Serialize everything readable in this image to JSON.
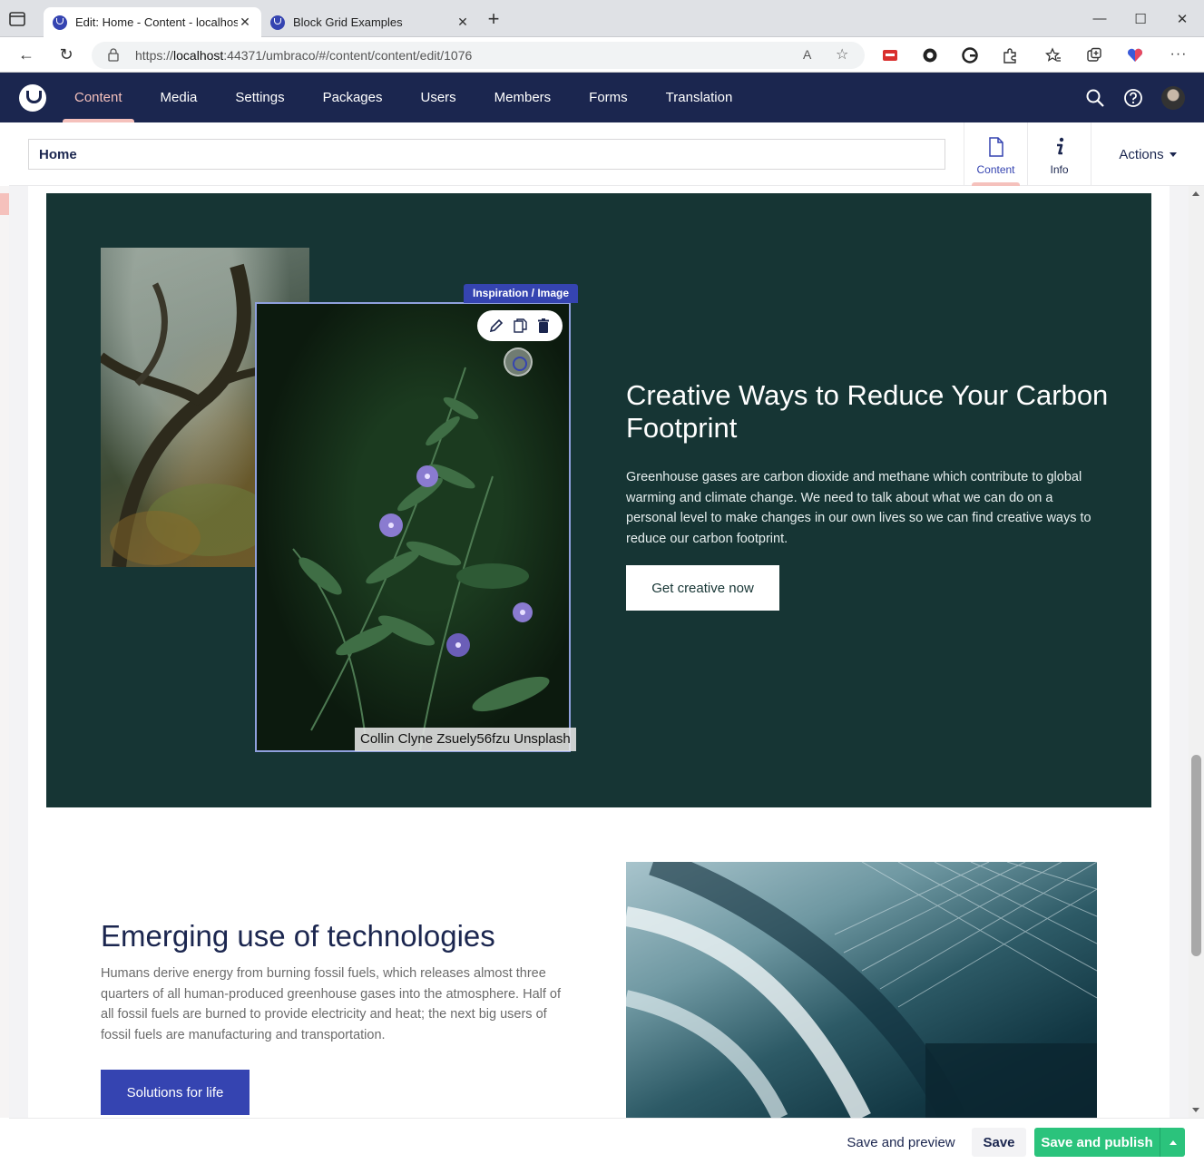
{
  "browser": {
    "tabs": [
      {
        "title": "Edit: Home - Content - localhost",
        "active": true
      },
      {
        "title": "Block Grid Examples",
        "active": false
      }
    ],
    "url_prefix": "https://",
    "url_host": "localhost",
    "url_rest": ":44371/umbraco/#/content/content/edit/1076",
    "read_aloud_label": "A̅̅"
  },
  "umbraco": {
    "sections": [
      "Content",
      "Media",
      "Settings",
      "Packages",
      "Users",
      "Members",
      "Forms",
      "Translation"
    ],
    "active_section": "Content",
    "accent_color": "#f5c1bc",
    "header_color": "#1b264f"
  },
  "editor": {
    "node_name": "Home",
    "apps": [
      {
        "label": "Content",
        "icon": "document-icon",
        "active": true
      },
      {
        "label": "Info",
        "icon": "info-icon",
        "active": false
      }
    ],
    "actions_label": "Actions"
  },
  "green_section": {
    "block_label": "Inspiration / Image",
    "image_caption": "Collin Clyne Zsuely56fzu Unsplash",
    "title": "Creative Ways to Reduce Your Carbon Footprint",
    "text": "Greenhouse gases are carbon dioxide and methane which contribute to global warming and climate change. We need to talk about what we can do on a personal level to make changes in our own lives so we can find creative ways to reduce our carbon footprint.",
    "button_label": "Get creative now",
    "background": "#163534"
  },
  "tech_section": {
    "title": "Emerging use of technologies",
    "text": "Humans derive energy from burning fossil fuels, which releases almost three quarters of all human-produced greenhouse gases into the atmosphere. Half of all fossil fuels are burned to provide electricity and heat; the next big users of fossil fuels are manufacturing and transportation.",
    "button_label": "Solutions for life",
    "button_color": "#3544b1"
  },
  "footer": {
    "preview_label": "Save and preview",
    "save_label": "Save",
    "publish_label": "Save and publish",
    "publish_color": "#2bc37c"
  }
}
